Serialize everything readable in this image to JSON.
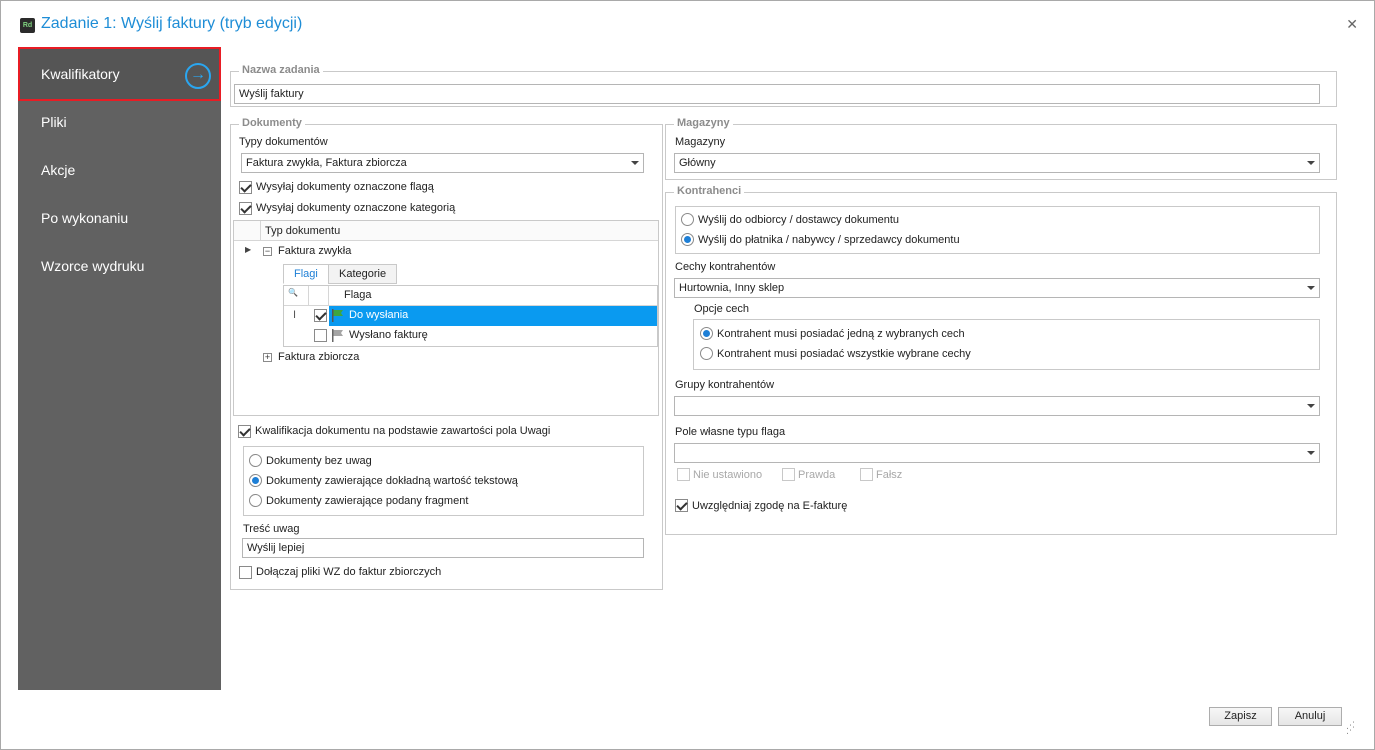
{
  "window": {
    "title": "Zadanie 1: Wyślij faktury (tryb edycji)",
    "app_icon_text": "Rd",
    "close_glyph": "✕"
  },
  "sidebar": {
    "items": [
      {
        "label": "Kwalifikatory",
        "active": true
      },
      {
        "label": "Pliki"
      },
      {
        "label": "Akcje"
      },
      {
        "label": "Po wykonaniu"
      },
      {
        "label": "Wzorce wydruku"
      }
    ],
    "active_arrow": "→"
  },
  "task_name": {
    "title": "Nazwa zadania",
    "value": "Wyślij faktury"
  },
  "documents": {
    "title": "Dokumenty",
    "types_label": "Typy dokumentów",
    "types_value": "Faktura zwykła, Faktura zbiorcza",
    "send_flagged_label": "Wysyłaj dokumenty oznaczone flagą",
    "send_category_label": "Wysyłaj dokumenty oznaczone kategorią",
    "tree": {
      "column_header": "Typ dokumentu",
      "node1": "Faktura zwykła",
      "node2": "Faktura zbiorcza",
      "tabs": [
        "Flagi",
        "Kategorie"
      ],
      "grid_header": "Flaga",
      "search_glyph": "🔍",
      "caret_glyph": "I",
      "rows": [
        {
          "label": "Do wysłania",
          "checked": true,
          "selected": true
        },
        {
          "label": "Wysłano fakturę",
          "checked": false,
          "selected": false
        }
      ]
    },
    "notes_qualification_label": "Kwalifikacja dokumentu na podstawie zawartości pola Uwagi",
    "notes_options": [
      "Dokumenty bez uwag",
      "Dokumenty zawierające dokładną wartość tekstową",
      "Dokumenty zawierające podany fragment"
    ],
    "notes_content_label": "Treść uwag",
    "notes_content_value": "Wyślij lepiej",
    "attach_wz_label": "Dołączaj pliki WZ do faktur zbiorczych"
  },
  "warehouses": {
    "title": "Magazyny",
    "label": "Magazyny",
    "value": "Główny"
  },
  "contractors": {
    "title": "Kontrahenci",
    "send_options": [
      "Wyślij do odbiorcy / dostawcy dokumentu",
      "Wyślij do płatnika / nabywcy / sprzedawcy dokumentu"
    ],
    "features_label": "Cechy kontrahentów",
    "features_value": "Hurtownia, Inny sklep",
    "features_options_title": "Opcje cech",
    "features_options": [
      "Kontrahent musi posiadać jedną z wybranych cech",
      "Kontrahent musi posiadać wszystkie wybrane cechy"
    ],
    "groups_label": "Grupy kontrahentów",
    "groups_value": "",
    "custom_flag_label": "Pole własne typu flaga",
    "custom_flag_value": "",
    "flag_checks": [
      "Nie ustawiono",
      "Prawda",
      "Fałsz"
    ],
    "efaktura_label": "Uwzględniaj zgodę na E-fakturę"
  },
  "footer": {
    "save": "Zapisz",
    "cancel": "Anuluj"
  },
  "colors": {
    "accent": "#1e8dd6",
    "sidebar": "#616161",
    "selection": "#0a9af0",
    "active_border": "#e81c24"
  }
}
